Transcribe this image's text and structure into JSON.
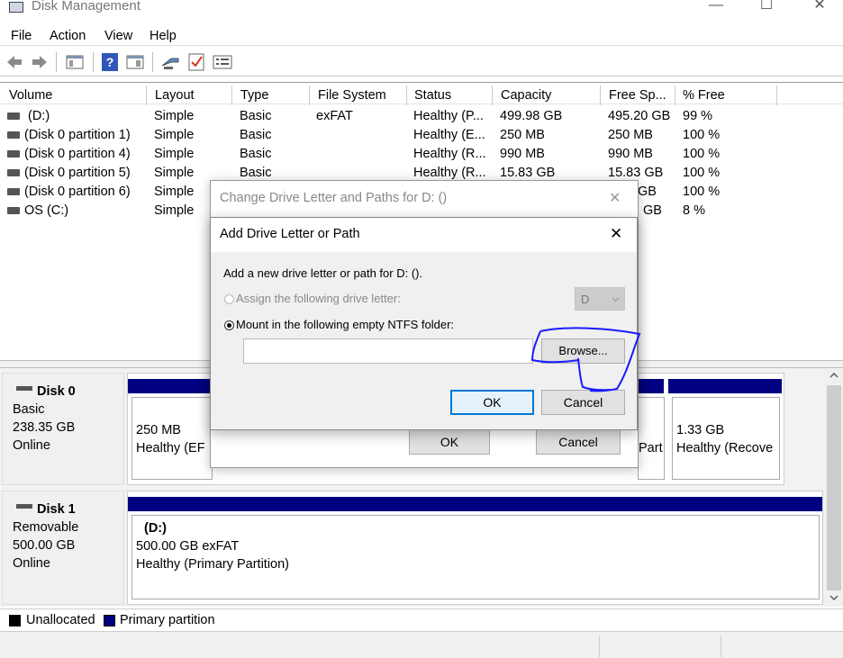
{
  "window": {
    "title": "Disk Management",
    "minimize": "—",
    "maximize": "☐",
    "close": "✕"
  },
  "menu": [
    "File",
    "Action",
    "View",
    "Help"
  ],
  "toolbar": [
    "back-icon",
    "forward-icon",
    "properties-pane-icon",
    "help-icon",
    "console-icon",
    "connect-icon",
    "check-icon",
    "list-icon"
  ],
  "columns": [
    "Volume",
    "Layout",
    "Type",
    "File System",
    "Status",
    "Capacity",
    "Free Sp...",
    "% Free"
  ],
  "volumes": [
    {
      "volume": "(D:)",
      "layout": "Simple",
      "type": "Basic",
      "fs": "exFAT",
      "status": "Healthy (P...",
      "capacity": "499.98 GB",
      "free": "495.20 GB",
      "pct": "99 %"
    },
    {
      "volume": "(Disk 0 partition 1)",
      "layout": "Simple",
      "type": "Basic",
      "fs": "",
      "status": "Healthy (E...",
      "capacity": "250 MB",
      "free": "250 MB",
      "pct": "100 %"
    },
    {
      "volume": "(Disk 0 partition 4)",
      "layout": "Simple",
      "type": "Basic",
      "fs": "",
      "status": "Healthy (R...",
      "capacity": "990 MB",
      "free": "990 MB",
      "pct": "100 %"
    },
    {
      "volume": "(Disk 0 partition 5)",
      "layout": "Simple",
      "type": "Basic",
      "fs": "",
      "status": "Healthy (R...",
      "capacity": "15.83 GB",
      "free": "15.83 GB",
      "pct": "100 %"
    },
    {
      "volume": "(Disk 0 partition 6)",
      "layout": "Simple",
      "type": "Basic",
      "fs": "",
      "status": "",
      "capacity": "",
      "free": "GB",
      "pct": "100 %"
    },
    {
      "volume": "OS (C:)",
      "layout": "Simple",
      "type": "",
      "fs": "",
      "status": "",
      "capacity": "",
      "free": "GB",
      "pct": "8 %"
    }
  ],
  "disks": [
    {
      "name": "Disk 0",
      "type": "Basic",
      "size": "238.35 GB",
      "state": "Online",
      "p1_size": "250 MB",
      "p1_status": "Healthy (EF",
      "p_mid_status": "Part",
      "p_last_size": "1.33 GB",
      "p_last_status": "Healthy (Recove"
    },
    {
      "name": "Disk 1",
      "type": "Removable",
      "size": "500.00 GB",
      "state": "Online",
      "part_label": "(D:)",
      "part_size": "500.00 GB exFAT",
      "part_status": "Healthy (Primary Partition)"
    }
  ],
  "legend": {
    "unallocated": "Unallocated",
    "primary": "Primary partition",
    "unallocated_color": "#000000",
    "primary_color": "#000080"
  },
  "dialog_back": {
    "title": "Change Drive Letter and Paths for D: ()",
    "ok": "OK",
    "cancel": "Cancel"
  },
  "dialog_front": {
    "title": "Add Drive Letter or Path",
    "prompt": "Add a new drive letter or path for D: ().",
    "assign_label": "Assign the following drive letter:",
    "drive_letter": "D",
    "mount_label": "Mount in the following empty NTFS folder:",
    "folder_value": "",
    "browse": "Browse...",
    "ok": "OK",
    "cancel": "Cancel"
  },
  "colors": {
    "accent": "#0078d7",
    "partition_header": "#000080",
    "annotation": "#1a1aff"
  }
}
